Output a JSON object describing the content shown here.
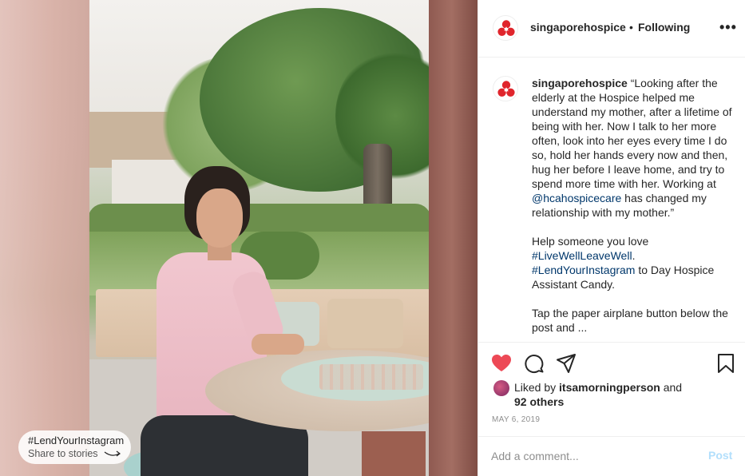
{
  "post": {
    "username": "singaporehospice",
    "separator": "•",
    "follow_status": "Following",
    "more_label": "•••"
  },
  "photo": {
    "share_tag": "#LendYourInstagram",
    "share_sub": "Share to stories"
  },
  "caption": {
    "username": "singaporehospice",
    "quote_part1": "“Looking after the elderly at the Hospice helped me understand my mother, after a lifetime of being with her. Now I talk to her more often, look into her eyes every time I do so, hold her hands every now and then, hug her before I leave home, and try to spend more time with her. Working at ",
    "mention": "@hcahospicecare",
    "quote_part2": " has changed my relationship with my mother.”",
    "help_line": "Help someone you love",
    "hashtag1": "#LiveWellLeaveWell",
    "hashtag1_suffix": ".",
    "hashtag2": "#LendYourInstagram",
    "hashtag2_suffix": " to Day Hospice Assistant Candy.",
    "tap_line": "Tap the paper airplane button below the post and ..."
  },
  "actions": {
    "heart_icon": "heart-icon",
    "comment_icon": "comment-icon",
    "share_icon": "paper-airplane-icon",
    "save_icon": "bookmark-icon",
    "heart_color": "#ed4956"
  },
  "likes": {
    "prefix": "Liked by ",
    "user": "itsamorningperson",
    "middle": " and",
    "others": "92 others"
  },
  "date": "MAY 6, 2019",
  "comment_box": {
    "placeholder": "Add a comment...",
    "post_label": "Post"
  },
  "colors": {
    "brand_red": "#e0252c",
    "link_blue": "#00376b",
    "post_disabled": "#b2dffc"
  }
}
